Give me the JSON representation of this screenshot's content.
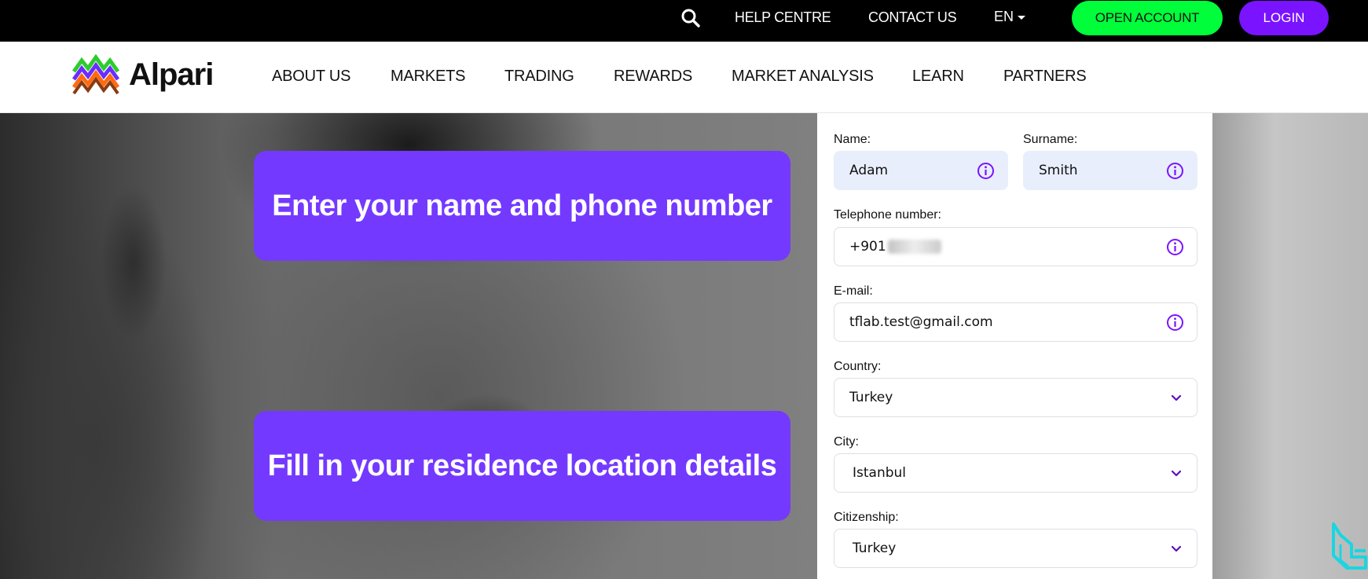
{
  "topbar": {
    "help_label": "HELP CENTRE",
    "contact_label": "CONTACT US",
    "language": "EN",
    "open_account_label": "OPEN ACCOUNT",
    "login_label": "LOGIN"
  },
  "brand": {
    "name": "Alpari"
  },
  "nav": {
    "items": [
      "ABOUT US",
      "MARKETS",
      "TRADING",
      "REWARDS",
      "MARKET ANALYSIS",
      "LEARN",
      "PARTNERS"
    ]
  },
  "hero": {
    "callout_1": "Enter your name and phone number",
    "callout_2": "Fill in your residence location details"
  },
  "form": {
    "name_label": "Name:",
    "name_value": "Adam",
    "surname_label": "Surname:",
    "surname_value": "Smith",
    "phone_label": "Telephone number:",
    "phone_value": "+901",
    "email_label": "E-mail:",
    "email_value": "tflab.test@gmail.com",
    "country_label": "Country:",
    "country_value": "Turkey",
    "city_label": "City:",
    "city_value": "Istanbul",
    "citizenship_label": "Citizenship:",
    "citizenship_value": "Turkey"
  },
  "colors": {
    "accent_purple": "#7a13ff",
    "callout_purple": "#7439ff",
    "open_account_green": "#00ff3a",
    "watermark_cyan": "#19d6e0"
  },
  "icons": [
    "search-icon",
    "chevron-down-icon",
    "info-icon",
    "alpari-logo-icon",
    "watermark-logo"
  ]
}
